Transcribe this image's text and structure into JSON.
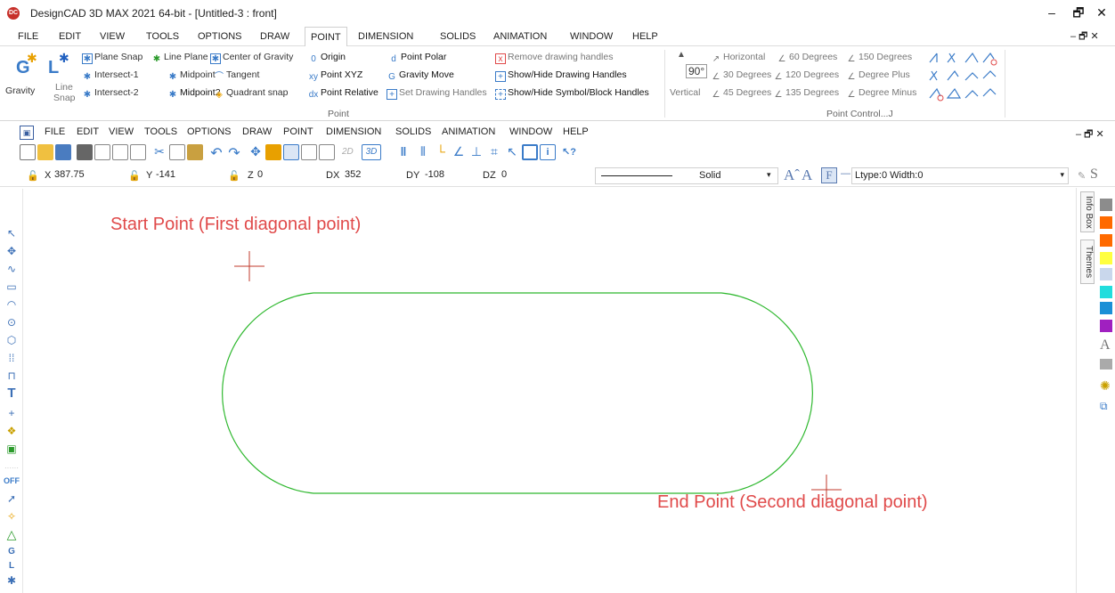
{
  "window": {
    "title": "DesignCAD 3D MAX 2021 64-bit - [Untitled-3 : front]",
    "logo": "DC",
    "minimize": "–",
    "restore": "🗗",
    "close": "✕"
  },
  "ribbon_tabs": [
    "FILE",
    "EDIT",
    "VIEW",
    "TOOLS",
    "OPTIONS",
    "DRAW",
    "POINT",
    "DIMENSION",
    "SOLIDS",
    "ANIMATION",
    "WINDOW",
    "HELP"
  ],
  "active_tab": "POINT",
  "ribbon_controls": "– 🗗 ✕",
  "ribbon": {
    "gravity": "Gravity",
    "line_snap_1": "Line",
    "line_snap_2": "Snap",
    "plane_snap": "Plane Snap",
    "line_plane": "Line Plane",
    "center_of_gravity": "Center of Gravity",
    "origin": "Origin",
    "point_polar": "Point Polar",
    "remove_handles": "Remove drawing handles",
    "intersect1": "Intersect-1",
    "midpoint": "Midpoint",
    "tangent": "Tangent",
    "point_xyz": "Point XYZ",
    "gravity_move": "Gravity Move",
    "show_hide_handles": "Show/Hide Drawing Handles",
    "intersect2": "Intersect-2",
    "midpoint2": "Midpoint2",
    "quadrant_snap": "Quadrant snap",
    "point_relative": "Point Relative",
    "set_handles": "Set Drawing Handles",
    "show_hide_symbol": "Show/Hide Symbol/Block Handles",
    "point_group": "Point",
    "vertical_value": "90°",
    "vertical": "Vertical",
    "horizontal": "Horizontal",
    "deg60": "60 Degrees",
    "deg150": "150 Degrees",
    "deg30": "30 Degrees",
    "deg120": "120 Degrees",
    "degree_plus": "Degree Plus",
    "deg45": "45 Degrees",
    "deg135": "135 Degrees",
    "degree_minus": "Degree Minus",
    "point_control_group": "Point Control...J"
  },
  "menu2": [
    "FILE",
    "EDIT",
    "VIEW",
    "TOOLS",
    "OPTIONS",
    "DRAW",
    "POINT",
    "DIMENSION",
    "SOLIDS",
    "ANIMATION",
    "WINDOW",
    "HELP"
  ],
  "menu2_controls": "– 🗗 ✕",
  "toolbar": {
    "btn_2d": "2D",
    "btn_3d": "3D",
    "help": "?"
  },
  "coords": {
    "x_label": "X",
    "x_value": "387.75",
    "y_label": "Y",
    "y_value": "-141",
    "z_label": "Z",
    "z_value": "0",
    "dx_label": "DX",
    "dx_value": "352",
    "dy_label": "DY",
    "dy_value": "-108",
    "dz_label": "DZ",
    "dz_value": "0",
    "line_style": "Solid",
    "ltype": "Ltype:0 Width:0",
    "dash": "—",
    "font_F": "F",
    "s_icon": "S"
  },
  "left_tools": {
    "off": "OFF"
  },
  "canvas": {
    "start_label": "Start Point (First diagonal point)",
    "end_label": "End Point (Second diagonal point)",
    "shape_color": "#2eb82e",
    "marker_color": "#c0392b"
  },
  "right_panel": {
    "info_box": "Info Box",
    "themes": "Themes",
    "swatches": [
      "#8c8c8c",
      "#ff6a00",
      "#ff6a00",
      "#ffff40",
      "#c9d7ec",
      "#22dddd",
      "#1a8fd6",
      "#a020c0"
    ]
  }
}
